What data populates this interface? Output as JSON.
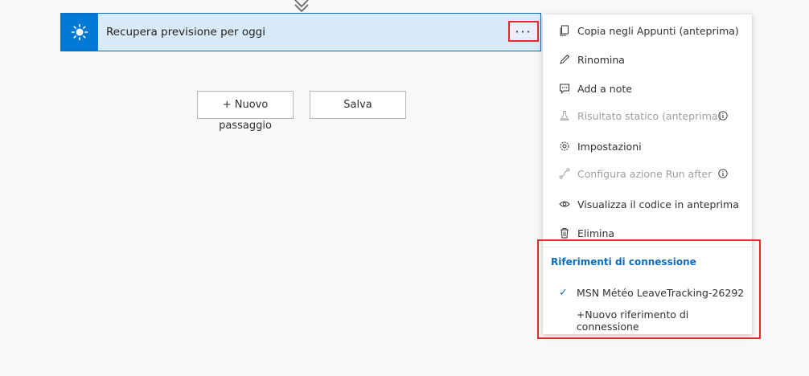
{
  "action_card": {
    "title": "Recupera previsione per oggi",
    "more_label": "···",
    "icon": "sun-icon"
  },
  "buttons": {
    "new_step_line1": "+ Nuovo",
    "new_step_line2": "passaggio",
    "save": "Salva"
  },
  "menu": {
    "items": [
      {
        "label": "Copia negli Appunti (anteprima)",
        "icon": "copy-icon",
        "disabled": false
      },
      {
        "label": "Rinomina",
        "icon": "pencil-icon",
        "disabled": false
      },
      {
        "label": "Add a note",
        "icon": "note-icon",
        "disabled": false
      },
      {
        "label": "Risultato statico (anteprima)",
        "icon": "flask-icon",
        "disabled": true,
        "info": true
      },
      {
        "label": "Impostazioni",
        "icon": "gear-icon",
        "disabled": false
      },
      {
        "label": "Configura azione Run after",
        "icon": "run-after-icon",
        "disabled": true,
        "info": true
      },
      {
        "label": "Visualizza il codice in anteprima",
        "icon": "eye-icon",
        "disabled": false
      },
      {
        "label": "Elimina",
        "icon": "trash-icon",
        "disabled": false
      }
    ],
    "connection_header": "Riferimenti di connessione",
    "connections": [
      {
        "label": "MSN Météo LeaveTracking-26292",
        "selected": true
      },
      {
        "label": "+Nuovo riferimento di connessione",
        "selected": false
      }
    ]
  },
  "colors": {
    "accent": "#0078d4",
    "highlight": "#e32b2b",
    "card_bg": "#d8e9f8"
  }
}
